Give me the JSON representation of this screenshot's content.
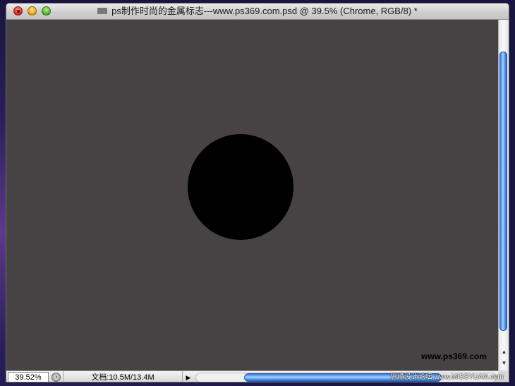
{
  "window": {
    "title": "ps制作时尚的金属标志---www.ps369.com.psd @ 39.5% (Chrome, RGB/8) *"
  },
  "canvas": {
    "background_color": "#474244",
    "shape_color": "#000000",
    "watermark": "www.ps369.com"
  },
  "statusbar": {
    "zoom": "39.52%",
    "doc_info": "文档:10.5M/13.4M"
  },
  "desktop": {
    "site_tag": "思缘设计论坛  www.MISSYUAN.com"
  },
  "icons": {
    "close": "close-icon",
    "minimize": "minimize-icon",
    "zoom": "zoom-icon",
    "document": "document-icon",
    "status_menu": "status-menu-icon",
    "arrow_right": "arrow-right-icon",
    "arrow_up": "arrow-up-icon",
    "arrow_down": "arrow-down-icon"
  },
  "colors": {
    "scroll_accent": "#3a78d8"
  }
}
